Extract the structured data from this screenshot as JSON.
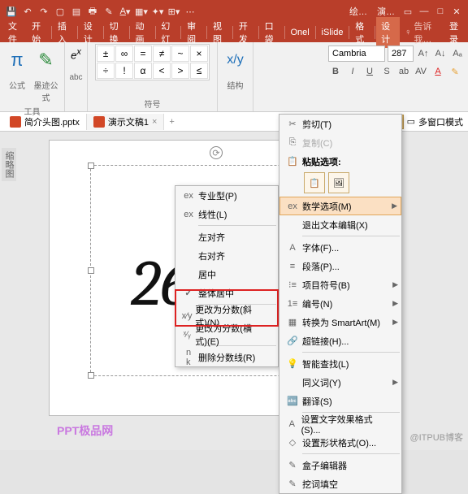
{
  "titlebar": {
    "txt1": "绘…",
    "txt2": "演…"
  },
  "tabs": {
    "file": "文件",
    "start": "开始",
    "insert": "插入",
    "design": "设计",
    "switch": "切换",
    "anim": "动画",
    "slide": "幻灯",
    "review": "审阅",
    "view": "视图",
    "dev": "开发",
    "pocket": "口袋",
    "onel": "Onel",
    "islide": "iSlide",
    "format": "格式",
    "design2": "设计",
    "tell": "告诉我…",
    "login": "登录"
  },
  "ribbon": {
    "formula": "公式",
    "ink": "墨迹公式",
    "tools": "工具",
    "abc": "abc",
    "symbols": "符号",
    "struct": "结构",
    "font": "Cambria",
    "size": "287"
  },
  "symbols": [
    "±",
    "∞",
    "=",
    "≠",
    "~",
    "×",
    "÷",
    "!",
    "α",
    "<",
    ">",
    "≤"
  ],
  "doctabs": {
    "t1": "简介头图.pptx",
    "t2": "演示文稿1",
    "multi": "多窗口模式"
  },
  "side": "缩略图",
  "bignum": "26",
  "watermark": "PPT极品网",
  "wmk2": "@ITPUB博客",
  "menu1": {
    "pro": "专业型(P)",
    "linear": "线性(L)",
    "left": "左对齐",
    "right": "右对齐",
    "center": "居中",
    "allcenter": "整体居中",
    "frac1": "更改为分数(斜式)(N)",
    "frac2": "更改为分数(横式)(E)",
    "delfrac": "删除分数线(R)"
  },
  "menu2": {
    "cut": "剪切(T)",
    "copy": "复制(C)",
    "pasteopt": "粘贴选项:",
    "mathopt": "数学选项(M)",
    "exit": "退出文本编辑(X)",
    "font": "字体(F)...",
    "para": "段落(P)...",
    "bullet": "项目符号(B)",
    "number": "编号(N)",
    "smartart": "转换为 SmartArt(M)",
    "link": "超链接(H)...",
    "smartfind": "智能查找(L)",
    "synonym": "同义词(Y)",
    "translate": "翻译(S)",
    "texteffect": "设置文字效果格式(S)...",
    "shapefmt": "设置形状格式(O)...",
    "boxedit": "盒子编辑器",
    "fillblank": "挖词填空"
  }
}
